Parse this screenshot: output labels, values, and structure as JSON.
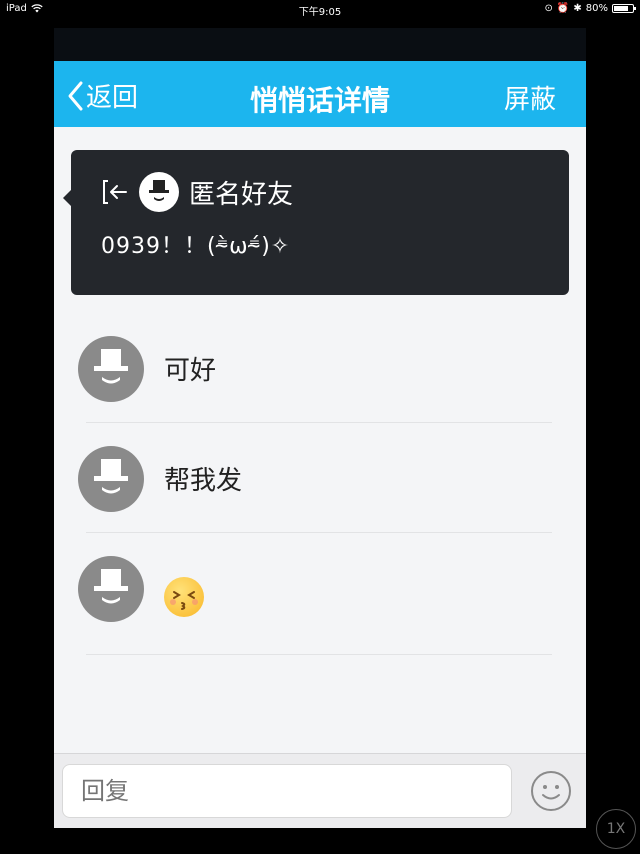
{
  "status_bar": {
    "device": "iPad",
    "time": "下午9:05",
    "battery": "80%",
    "battery_level": 0.8
  },
  "navbar": {
    "back_label": "返回",
    "title": "悄悄话详情",
    "right_label": "屏蔽"
  },
  "message": {
    "sender": "匿名好友",
    "text": "0939！！(⁼̴̀ω⁼̴́)✧"
  },
  "replies": [
    {
      "text": "可好"
    },
    {
      "text": "帮我发"
    },
    {
      "text": "",
      "icon": "kiss-emoji-icon"
    }
  ],
  "reply_input": {
    "placeholder": "回复"
  },
  "zoom_badge": "1X",
  "colors": {
    "navbar": "#1cb5ee",
    "card": "#24272c",
    "background": "#f4f5f7"
  }
}
